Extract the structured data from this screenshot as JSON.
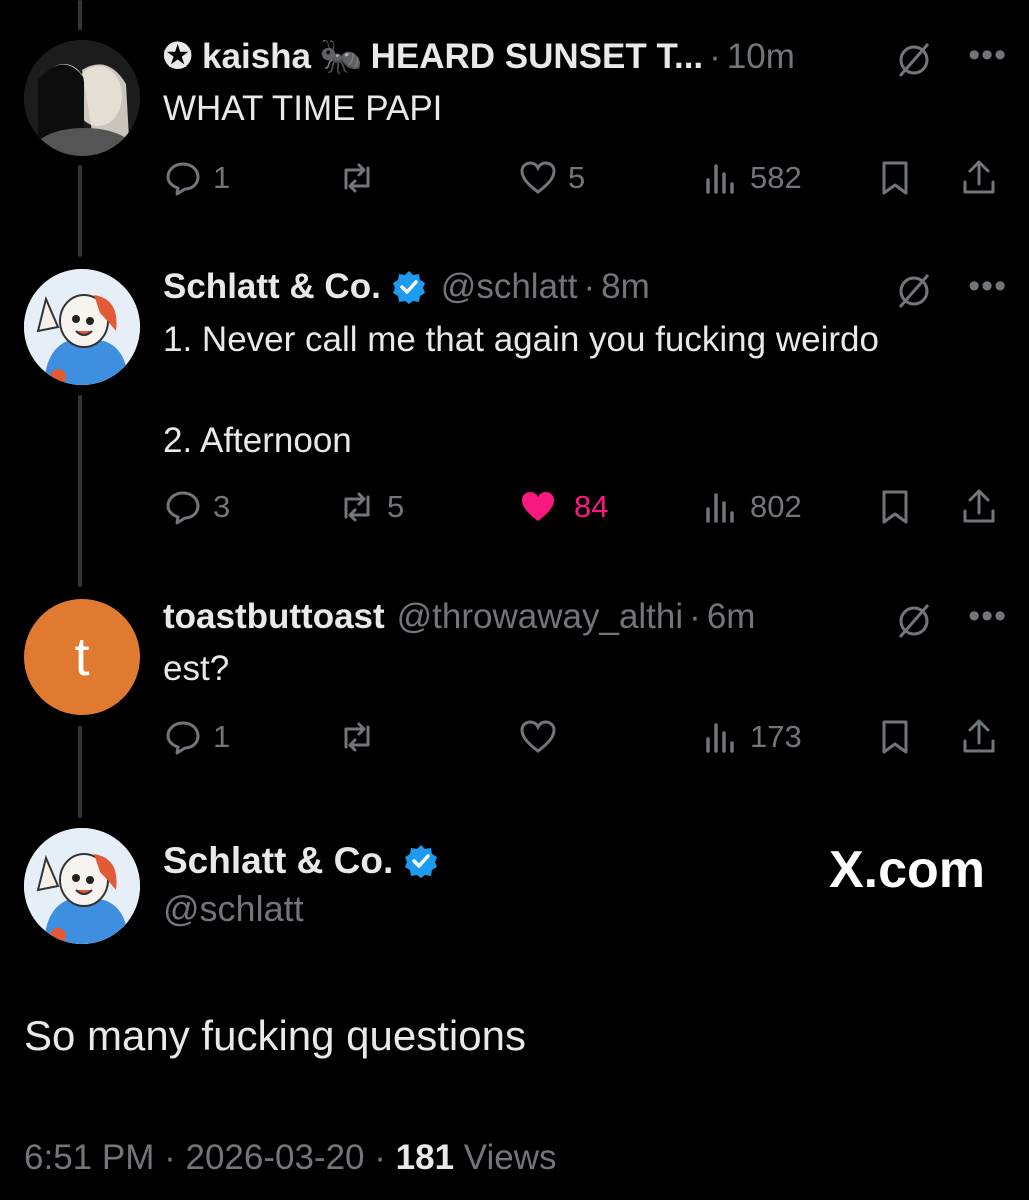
{
  "tweets": [
    {
      "name": "✪ kaisha",
      "name_suffix": "HEARD SUNSET T...",
      "ant_emoji": "🐜",
      "handle": "",
      "time": "10m",
      "text": "WHAT TIME PAPI",
      "replies": "1",
      "reposts": "",
      "likes": "5",
      "views": "582",
      "liked": false
    },
    {
      "name": "Schlatt & Co.",
      "handle": "@schlatt",
      "time": "8m",
      "text_line1": "1. Never call me that again you fucking weirdo",
      "text_line2": "2. Afternoon",
      "replies": "3",
      "reposts": "5",
      "likes": "84",
      "views": "802",
      "liked": true
    },
    {
      "name": "toastbuttoast",
      "handle": "@throwaway_althi",
      "time": "6m",
      "text": "est?",
      "avatar_letter": "t",
      "replies": "1",
      "reposts": "",
      "likes": "",
      "views": "173",
      "liked": false
    }
  ],
  "main": {
    "name": "Schlatt & Co.",
    "handle": "@schlatt",
    "brand": "X.com",
    "text": "So many fucking questions",
    "time": "6:51 PM",
    "date": "2026-03-20",
    "views_count": "181",
    "views_label": "Views"
  },
  "separator": "·",
  "colors": {
    "like_active": "#f91880",
    "verified": "#1d9bf0",
    "muted": "#71767b",
    "avatar_orange": "#e07a30"
  }
}
